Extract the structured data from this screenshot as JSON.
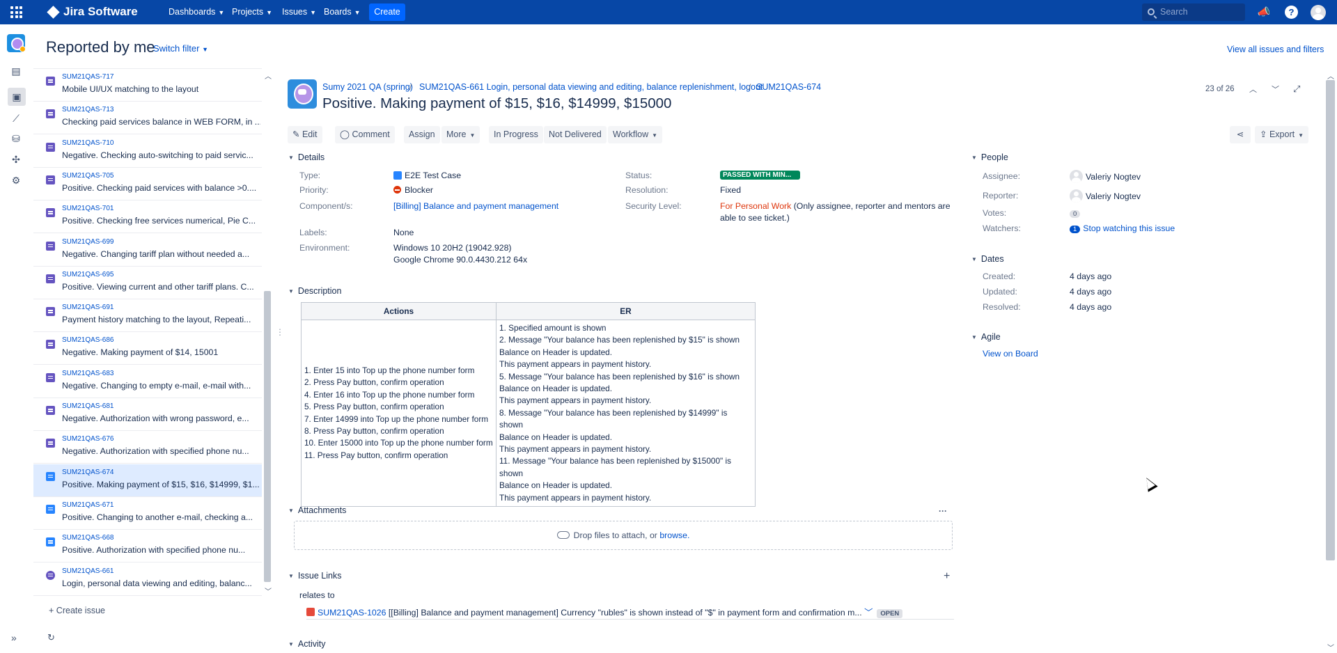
{
  "topnav": {
    "logo": "Jira Software",
    "items": [
      {
        "label": "Dashboards"
      },
      {
        "label": "Projects"
      },
      {
        "label": "Issues"
      },
      {
        "label": "Boards"
      }
    ],
    "create": "Create",
    "search_placeholder": "Search"
  },
  "header": {
    "title": "Reported by me",
    "switch_filter": "Switch filter",
    "view_all": "View all issues and filters"
  },
  "list": {
    "items": [
      {
        "key": "SUM21QAS-717",
        "summary": "Mobile UI/UX matching to the layout",
        "icon": "test-icon"
      },
      {
        "key": "SUM21QAS-713",
        "summary": "Checking paid services balance in WEB FORM, in ...",
        "icon": "test-icon"
      },
      {
        "key": "SUM21QAS-710",
        "summary": "Negative. Checking auto-switching to paid servic...",
        "icon": "test-icon"
      },
      {
        "key": "SUM21QAS-705",
        "summary": "Positive. Checking paid services with balance >0....",
        "icon": "test-icon"
      },
      {
        "key": "SUM21QAS-701",
        "summary": "Positive. Checking free services numerical, Pie C...",
        "icon": "test-icon"
      },
      {
        "key": "SUM21QAS-699",
        "summary": "Negative. Changing tariff plan without needed a...",
        "icon": "test-icon"
      },
      {
        "key": "SUM21QAS-695",
        "summary": "Positive. Viewing current and other tariff plans. C...",
        "icon": "test-icon"
      },
      {
        "key": "SUM21QAS-691",
        "summary": "Payment history matching to the layout, Repeati...",
        "icon": "test-icon"
      },
      {
        "key": "SUM21QAS-686",
        "summary": "Negative. Making payment of $14, 15001",
        "icon": "test-icon"
      },
      {
        "key": "SUM21QAS-683",
        "summary": "Negative. Changing to empty e-mail, e-mail with...",
        "icon": "test-icon"
      },
      {
        "key": "SUM21QAS-681",
        "summary": "Negative. Authorization with wrong password, e...",
        "icon": "test-icon"
      },
      {
        "key": "SUM21QAS-676",
        "summary": "Negative. Authorization with specified phone nu...",
        "icon": "test-icon"
      },
      {
        "key": "SUM21QAS-674",
        "summary": "Positive. Making payment of $15, $16, $14999, $1...",
        "icon": "e2e-icon"
      },
      {
        "key": "SUM21QAS-671",
        "summary": "Positive. Changing to another e-mail, checking a...",
        "icon": "e2e-icon"
      },
      {
        "key": "SUM21QAS-668",
        "summary": "Positive. Authorization with specified phone nu...",
        "icon": "e2e-icon"
      },
      {
        "key": "SUM21QAS-661",
        "summary": "Login, personal data viewing and editing, balanc...",
        "icon": "epic-icon"
      }
    ],
    "selected_index": 12,
    "create_issue": "Create issue"
  },
  "issue": {
    "breadcrumb": [
      "Sumy 2021 QA (spring)",
      "SUM21QAS-661 Login, personal data viewing and editing, balance replenishment, logout",
      "SUM21QAS-674"
    ],
    "title": "Positive. Making payment of $15, $16, $14999, $15000",
    "pager": "23 of 26",
    "toolbar": {
      "edit": "Edit",
      "comment": "Comment",
      "assign": "Assign",
      "more": "More",
      "in_progress": "In Progress",
      "not_delivered": "Not Delivered",
      "workflow": "Workflow",
      "export": "Export"
    },
    "details": {
      "header": "Details",
      "type_label": "Type:",
      "type": "E2E Test Case",
      "priority_label": "Priority:",
      "priority": "Blocker",
      "components_label": "Component/s:",
      "components": "[Billing] Balance and payment management",
      "labels_label": "Labels:",
      "labels": "None",
      "environment_label": "Environment:",
      "environment_1": "Windows 10 20H2 (19042.928)",
      "environment_2": "Google Chrome 90.0.4430.212 64x",
      "status_label": "Status:",
      "status": "PASSED WITH MIN...",
      "resolution_label": "Resolution:",
      "resolution": "Fixed",
      "security_label": "Security Level:",
      "security": "For Personal Work",
      "security_note_1": "(Only assignee, reporter and mentors are",
      "security_note_2": "able to see ticket.)"
    },
    "description": {
      "header": "Description",
      "col_actions": "Actions",
      "col_er": "ER",
      "actions": [
        "1. Enter 15 into Top up the phone number form",
        "2. Press Pay button, confirm operation",
        "4. Enter 16 into Top up the phone number form",
        "5. Press Pay button, confirm operation",
        "7. Enter 14999 into Top up the phone number form",
        "8. Press Pay button, confirm operation",
        "10. Enter 15000 into Top up the phone number form",
        "11. Press Pay button, confirm operation"
      ],
      "er": [
        "1. Specified amount is shown",
        "2. Message \"Your balance has been replenished by $15\" is shown",
        "Balance on Header is updated.",
        "This payment appears in payment history.",
        "5. Message \"Your balance has been replenished by $16\" is shown",
        "Balance on Header is updated.",
        "This payment appears in payment history.",
        "8. Message \"Your balance has been replenished by $14999\" is shown",
        "Balance on Header is updated.",
        "This payment appears in payment history.",
        "11. Message \"Your balance has been replenished by $15000\" is shown",
        "Balance on Header is updated.",
        "This payment appears in payment history."
      ]
    },
    "attachments": {
      "header": "Attachments",
      "drop_text": "Drop files to attach, or",
      "browse": "browse."
    },
    "links": {
      "header": "Issue Links",
      "relation": "relates to",
      "key": "SUM21QAS-1026",
      "summary": "[[Billing] Balance and payment management] Currency \"rubles\" is shown instead of \"$\" in payment form and confirmation m...",
      "status": "OPEN"
    },
    "activity": {
      "header": "Activity"
    },
    "people": {
      "header": "People",
      "assignee_label": "Assignee:",
      "assignee": "Valeriy Nogtev",
      "reporter_label": "Reporter:",
      "reporter": "Valeriy Nogtev",
      "votes_label": "Votes:",
      "votes": "0",
      "watchers_label": "Watchers:",
      "watchers": "1",
      "watch_link": "Stop watching this issue"
    },
    "dates": {
      "header": "Dates",
      "created_label": "Created:",
      "created": "4 days ago",
      "updated_label": "Updated:",
      "updated": "4 days ago",
      "resolved_label": "Resolved:",
      "resolved": "4 days ago"
    },
    "agile": {
      "header": "Agile",
      "view_on_board": "View on Board"
    }
  },
  "colors": {
    "topbar": "#0747a6",
    "accent": "#0052cc",
    "status_green": "#00875a",
    "blocker_red": "#de350b"
  }
}
